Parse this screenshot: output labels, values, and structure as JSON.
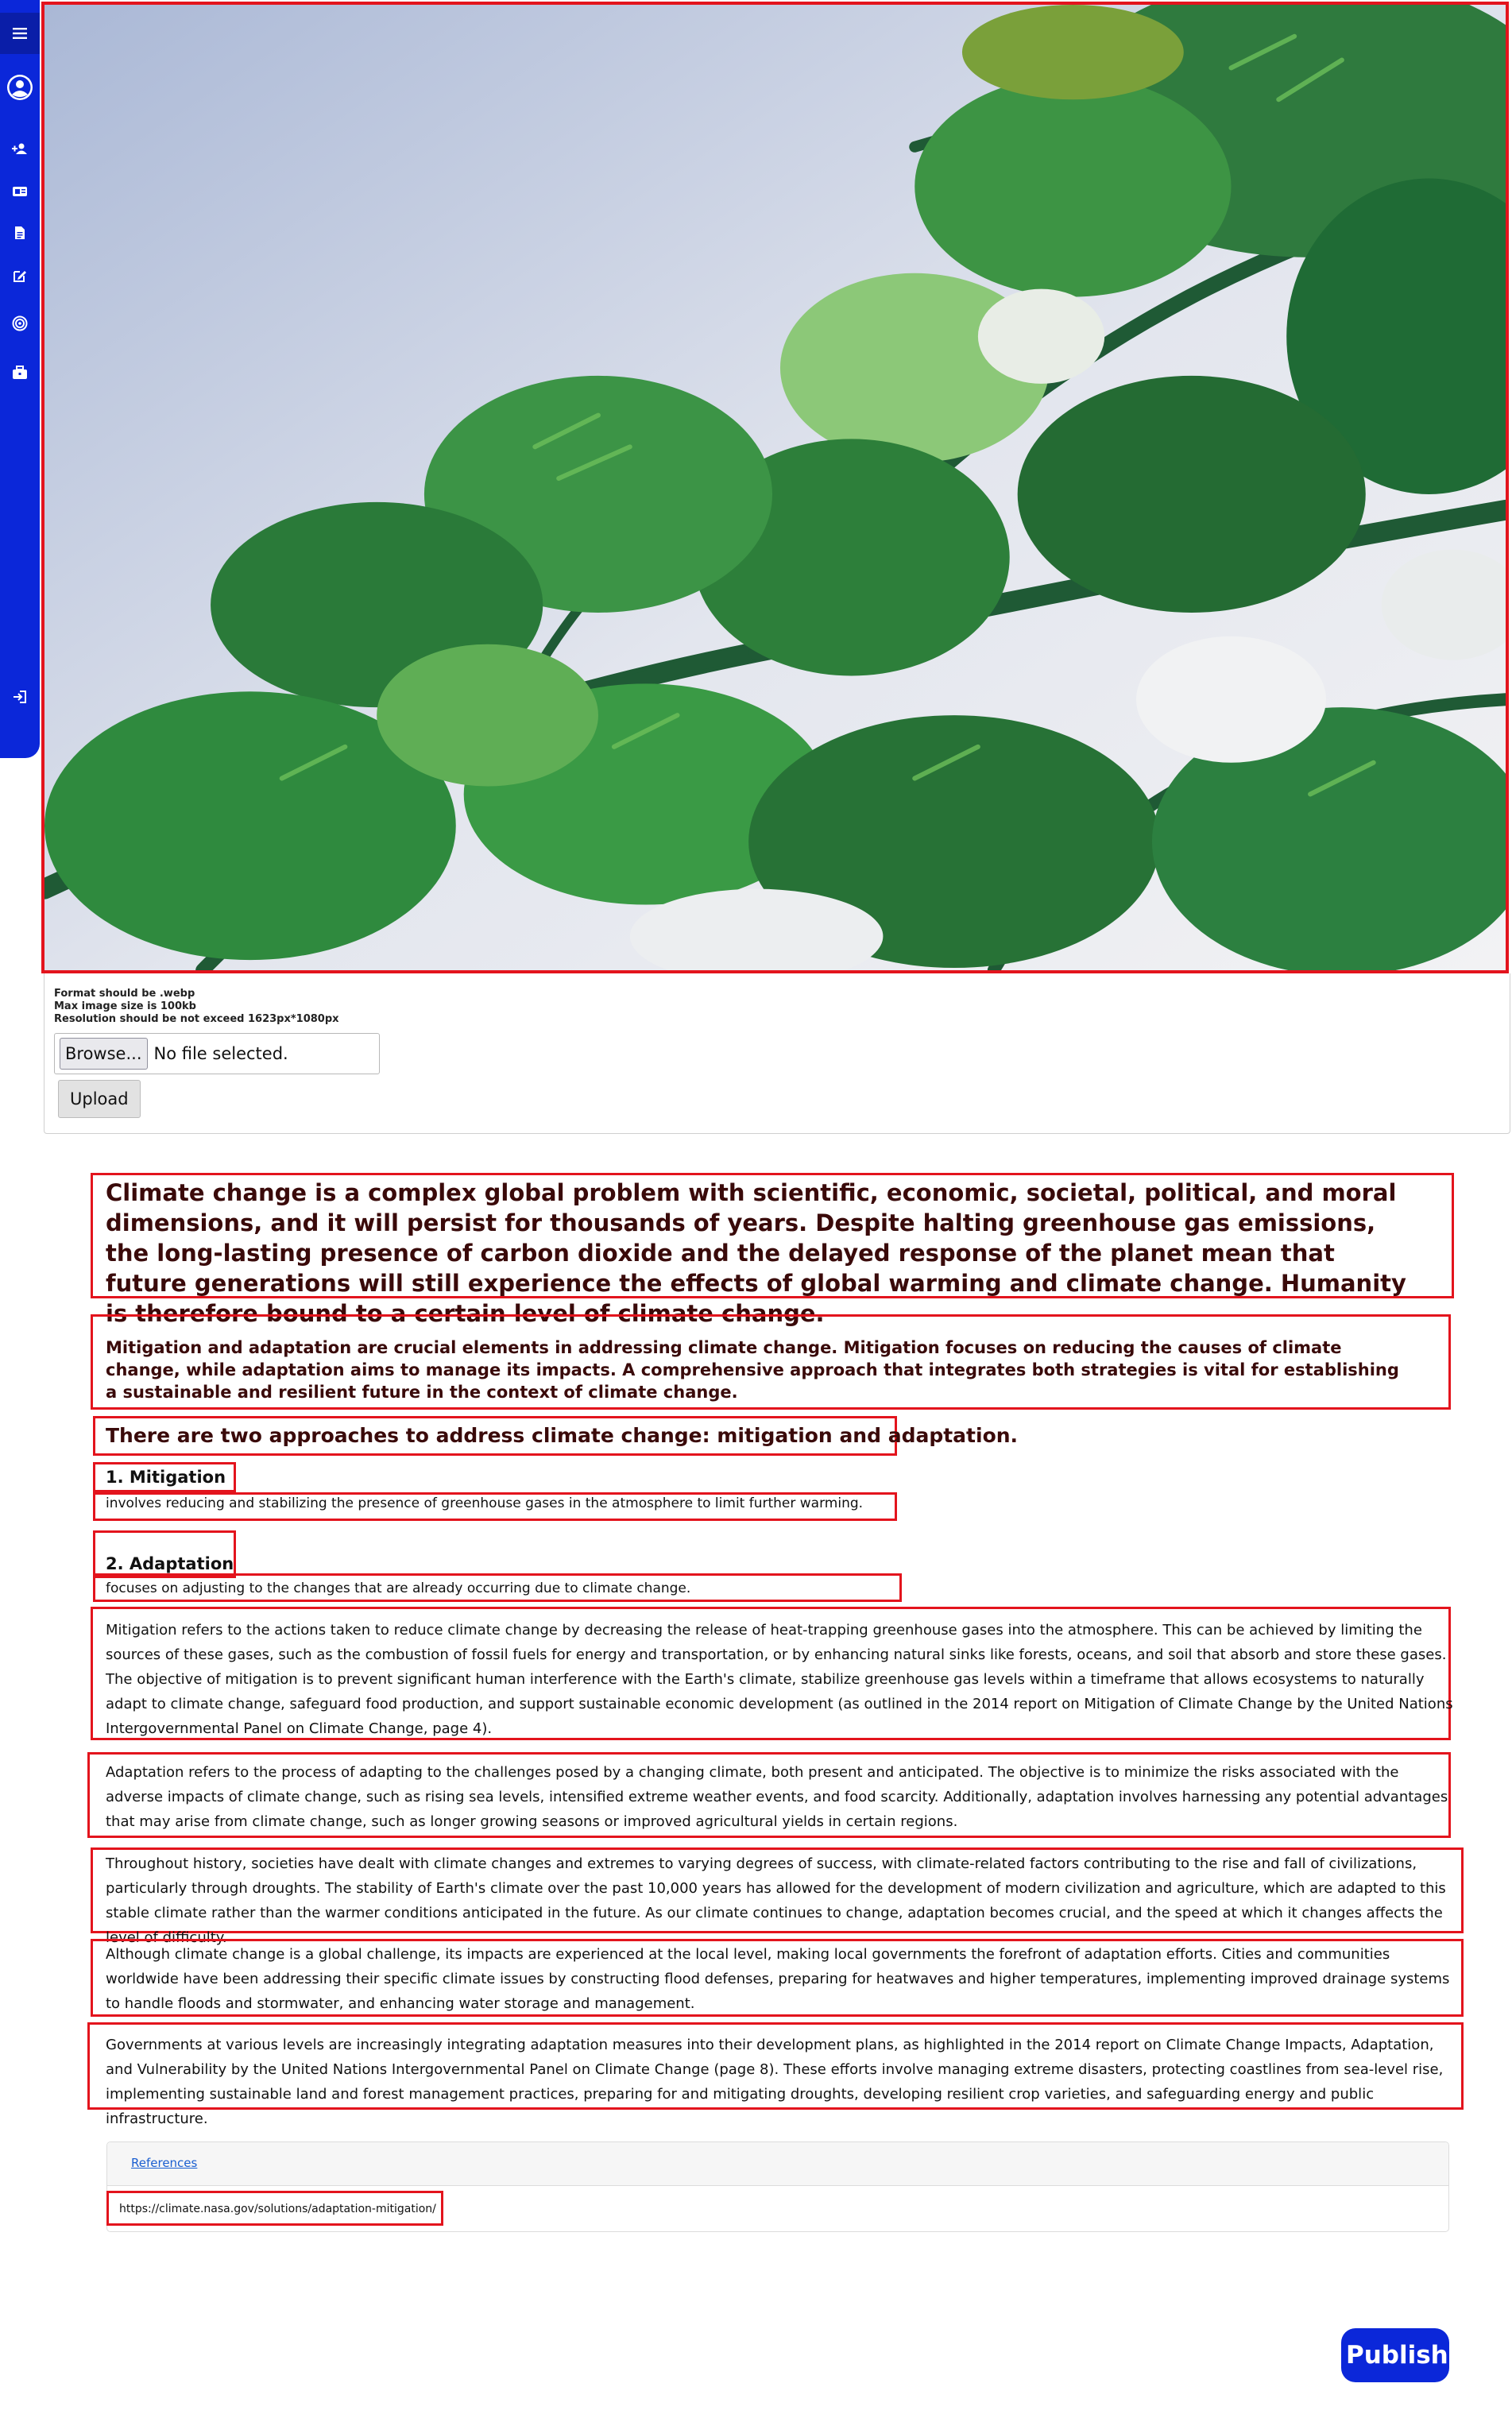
{
  "sidebar": {
    "icons": [
      "menu-icon",
      "user-circle-icon",
      "add-user-icon",
      "id-card-icon",
      "document-icon",
      "edit-icon",
      "target-icon",
      "briefcase-icon",
      "logout-icon"
    ]
  },
  "upload": {
    "format_hint": "Format should be .webp",
    "size_hint": "Max image size is 100kb",
    "resolution_hint": "Resolution should be not exceed 1623px*1080px",
    "browse_label": "Browse...",
    "file_status": "No file selected.",
    "upload_label": "Upload"
  },
  "article": {
    "lead": "Climate change is a complex global problem with scientific, economic, societal, political, and moral dimensions, and it will persist for thousands of years. Despite halting greenhouse gas emissions, the long-lasting presence of carbon dioxide and the delayed response of the planet mean that future generations will still experience the effects of global warming and climate change. Humanity is therefore bound to a certain level of climate change.",
    "intro": "Mitigation and adaptation are crucial elements in addressing climate change. Mitigation focuses on reducing the causes of climate change, while adaptation aims to manage its impacts. A comprehensive approach that integrates both strategies is vital for establishing a sustainable and resilient future in the context of climate change.",
    "approach": "There are two approaches to address climate change: mitigation and adaptation.",
    "mitigation_title": "1. Mitigation",
    "mitigation_text": "involves reducing and stabilizing the presence of greenhouse gases in the atmosphere to limit further warming.",
    "adaptation_title": "2. Adaptation",
    "adaptation_text": "focuses on adjusting to the changes that are already occurring due to climate change.",
    "p1": "Mitigation refers to the actions taken to reduce climate change by decreasing the release of heat-trapping greenhouse gases into the atmosphere. This can be achieved by limiting the sources of these gases, such as the combustion of fossil fuels for energy and transportation, or by enhancing natural sinks like forests, oceans, and soil that absorb and store these gases. The objective of mitigation is to prevent significant human interference with the Earth's climate, stabilize greenhouse gas levels within a timeframe that allows ecosystems to naturally adapt to climate change, safeguard food production, and support sustainable economic development (as outlined in the 2014 report on Mitigation of Climate Change by the United Nations Intergovernmental Panel on Climate Change, page 4).",
    "p2": "Adaptation refers to the process of adapting to the challenges posed by a changing climate, both present and anticipated. The objective is to minimize the risks associated with the adverse impacts of climate change, such as rising sea levels, intensified extreme weather events, and food scarcity. Additionally, adaptation involves harnessing any potential advantages that may arise from climate change, such as longer growing seasons or improved agricultural yields in certain regions.",
    "p3": "Throughout history, societies have dealt with climate changes and extremes to varying degrees of success, with climate-related factors contributing to the rise and fall of civilizations, particularly through droughts. The stability of Earth's climate over the past 10,000 years has allowed for the development of modern civilization and agriculture, which are adapted to this stable climate rather than the warmer conditions anticipated in the future. As our climate continues to change, adaptation becomes crucial, and the speed at which it changes affects the level of difficulty.",
    "p4": "Although climate change is a global challenge, its impacts are experienced at the local level, making local governments the forefront of adaptation efforts. Cities and communities worldwide have been addressing their specific climate issues by constructing flood defenses, preparing for heatwaves and higher temperatures, implementing improved drainage systems to handle floods and stormwater, and enhancing water storage and management.",
    "p5": "Governments at various levels are increasingly integrating adaptation measures into their development plans, as highlighted in the 2014 report on Climate Change Impacts, Adaptation, and Vulnerability by the United Nations Intergovernmental Panel on Climate Change (page 8). These efforts involve managing extreme disasters, protecting coastlines from sea-level rise, implementing sustainable land and forest management practices, preparing for and mitigating droughts, developing resilient crop varieties, and safeguarding energy and public infrastructure."
  },
  "references": {
    "label": "References",
    "url": "https://climate.nasa.gov/solutions/adaptation-mitigation/"
  },
  "publish_label": "Publish",
  "colors": {
    "brand_blue": "#0b27d9",
    "highlight_red": "#e3141d",
    "heading_text": "#3a0a0a"
  }
}
